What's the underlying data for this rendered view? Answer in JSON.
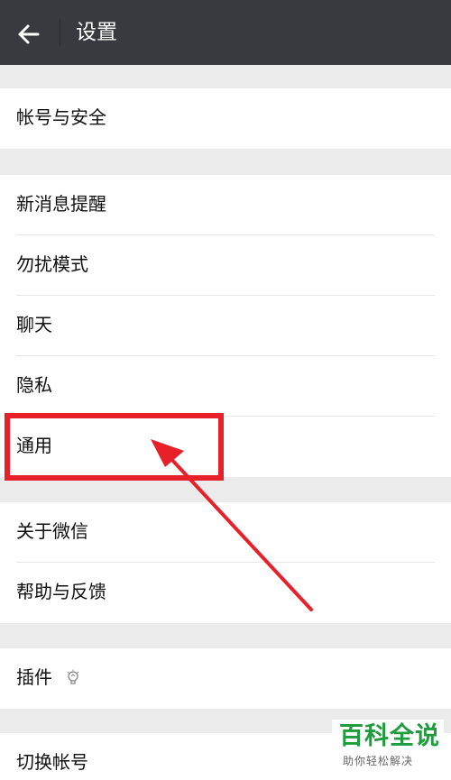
{
  "header": {
    "title": "设置",
    "back_icon": "arrow-left-icon"
  },
  "groups": [
    {
      "items": [
        {
          "label": "帐号与安全"
        }
      ]
    },
    {
      "items": [
        {
          "label": "新消息提醒"
        },
        {
          "label": "勿扰模式"
        },
        {
          "label": "聊天"
        },
        {
          "label": "隐私"
        },
        {
          "label": "通用"
        }
      ]
    },
    {
      "items": [
        {
          "label": "关于微信"
        },
        {
          "label": "帮助与反馈"
        }
      ]
    },
    {
      "items": [
        {
          "label": "插件",
          "icon": "lightbulb-icon"
        }
      ]
    },
    {
      "items": [
        {
          "label": "切换帐号"
        }
      ]
    }
  ],
  "annotation": {
    "highlight_color": "#e8202a"
  },
  "watermark": {
    "title": "百科全说",
    "subtitle": "助你轻松解决"
  },
  "colors": {
    "header_bg": "#393a3f",
    "page_bg": "#ebebeb",
    "watermark_green": "#1f9d3e"
  }
}
